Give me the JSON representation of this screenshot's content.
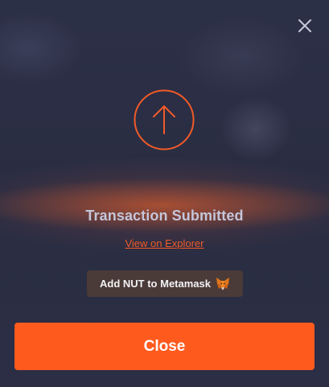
{
  "modal": {
    "close_icon": "close-icon",
    "status_icon": "arrow-up-circle-icon",
    "title": "Transaction Submitted",
    "explorer_link": "View on Explorer",
    "add_token": {
      "label": "Add NUT to Metamask",
      "icon": "metamask-fox-icon"
    },
    "close_button": "Close"
  },
  "colors": {
    "background": "#2a2d42",
    "accent": "#ff5a1e",
    "link": "#ef5a2a",
    "title": "#c4c6da",
    "add_token_bg": "#4a3a38"
  }
}
